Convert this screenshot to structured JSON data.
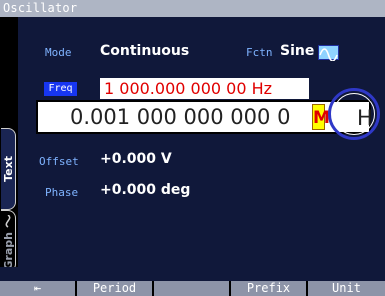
{
  "window": {
    "title": "Oscillator"
  },
  "params": {
    "mode": {
      "label": "Mode",
      "value": "Continuous"
    },
    "fctn": {
      "label": "Fctn",
      "value": "Sine",
      "icon": "sine-wave-icon"
    },
    "freq": {
      "label": "Freq",
      "value": "1 000.000 000 00 Hz"
    },
    "edit": {
      "digits": "0.001 000 000 000 0",
      "cursor_digit": "M",
      "tail": "H"
    },
    "offset": {
      "label": "Offset",
      "value": "+0.000 V"
    },
    "phase": {
      "label": "Phase",
      "value": "+0.000 deg"
    }
  },
  "tabs": {
    "text": "Text",
    "graph": "Graph"
  },
  "softkeys": {
    "back": "⇤",
    "period": "Period",
    "empty": "",
    "prefix": "Prefix",
    "unit": "Unit"
  },
  "colors": {
    "accent": "#1736f1",
    "highlight": "#ffff00",
    "annotation": "#2f38c7"
  }
}
